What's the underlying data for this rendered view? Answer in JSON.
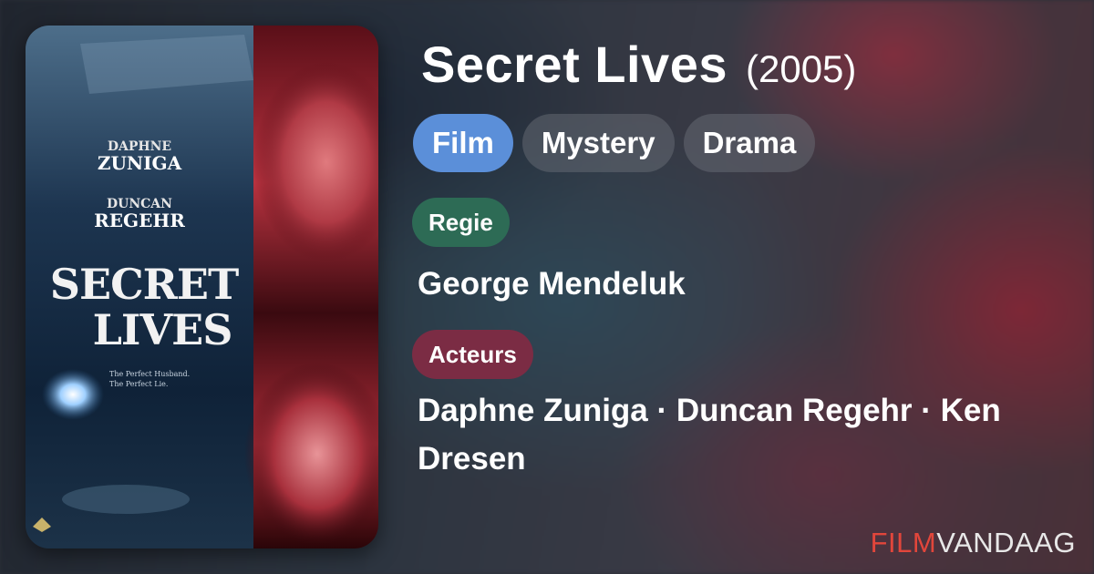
{
  "movie": {
    "title": "Secret Lives",
    "year": "(2005)",
    "genres": [
      "Film",
      "Mystery",
      "Drama"
    ],
    "director_label": "Regie",
    "director": "George Mendeluk",
    "actors_label": "Acteurs",
    "actors": "Daphne Zuniga · Duncan Regehr · Ken Dresen"
  },
  "poster": {
    "actor1_first": "DAPHNE",
    "actor1_last": "ZUNIGA",
    "actor2_first": "DUNCAN",
    "actor2_last": "REGEHR",
    "title_line1": "SECRET",
    "title_line2": "LIVES",
    "tagline1": "The Perfect Husband.",
    "tagline2": "The Perfect Lie."
  },
  "brand": {
    "part1": "FILM",
    "part2": "VANDAAG"
  },
  "colors": {
    "film_chip": "#5b8fd9",
    "regie_label": "#2d6b55",
    "acteurs_label": "#7b2c44",
    "brand_red": "#e2463b"
  }
}
